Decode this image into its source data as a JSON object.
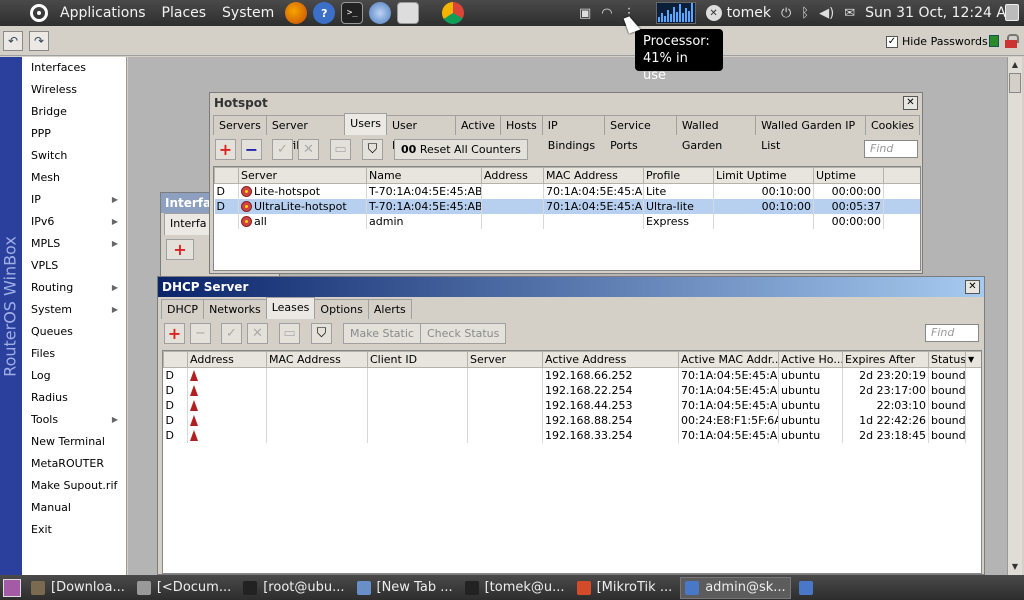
{
  "top_panel": {
    "menus": [
      "Applications",
      "Places",
      "System"
    ],
    "user": "tomek",
    "clock": "Sun 31 Oct, 12:24 AM"
  },
  "tooltip": {
    "line1": "Processor:",
    "line2": "41% in use"
  },
  "winbox_toolbar": {
    "hide_passwords_label": "Hide Passwords",
    "hide_passwords_checked": true
  },
  "brand": "RouterOS WinBox",
  "sidebar": {
    "items": [
      {
        "label": "Interfaces",
        "submenu": false
      },
      {
        "label": "Wireless",
        "submenu": false
      },
      {
        "label": "Bridge",
        "submenu": false
      },
      {
        "label": "PPP",
        "submenu": false
      },
      {
        "label": "Switch",
        "submenu": false
      },
      {
        "label": "Mesh",
        "submenu": false
      },
      {
        "label": "IP",
        "submenu": true
      },
      {
        "label": "IPv6",
        "submenu": true
      },
      {
        "label": "MPLS",
        "submenu": true
      },
      {
        "label": "VPLS",
        "submenu": false
      },
      {
        "label": "Routing",
        "submenu": true
      },
      {
        "label": "System",
        "submenu": true
      },
      {
        "label": "Queues",
        "submenu": false
      },
      {
        "label": "Files",
        "submenu": false
      },
      {
        "label": "Log",
        "submenu": false
      },
      {
        "label": "Radius",
        "submenu": false
      },
      {
        "label": "Tools",
        "submenu": true
      },
      {
        "label": "New Terminal",
        "submenu": false
      },
      {
        "label": "MetaROUTER",
        "submenu": false
      },
      {
        "label": "Make Supout.rif",
        "submenu": false
      },
      {
        "label": "Manual",
        "submenu": false
      },
      {
        "label": "Exit",
        "submenu": false
      }
    ]
  },
  "interface_window": {
    "title": "Interfa",
    "tab": "Interfa"
  },
  "hotspot": {
    "title": "Hotspot",
    "tabs": [
      "Servers",
      "Server Profiles",
      "Users",
      "User Profiles",
      "Active",
      "Hosts",
      "IP Bindings",
      "Service Ports",
      "Walled Garden",
      "Walled Garden IP List",
      "Cookies"
    ],
    "active_tab": "Users",
    "reset_label": "Reset All Counters",
    "reset_prefix": "00",
    "find_placeholder": "Find",
    "columns": [
      "Server",
      "Name",
      "Address",
      "MAC Address",
      "Profile",
      "Limit Uptime",
      "Uptime"
    ],
    "rows": [
      {
        "flag": "D",
        "server": "Lite-hotspot",
        "name": "T-70:1A:04:5E:45:AB",
        "address": "",
        "mac": "70:1A:04:5E:45:AB",
        "profile": "Lite",
        "limit_uptime": "00:10:00",
        "uptime": "00:00:00"
      },
      {
        "flag": "D",
        "server": "UltraLite-hotspot",
        "name": "T-70:1A:04:5E:45:AB",
        "address": "",
        "mac": "70:1A:04:5E:45:AB",
        "profile": "Ultra-lite",
        "limit_uptime": "00:10:00",
        "uptime": "00:05:37"
      },
      {
        "flag": "",
        "server": "all",
        "name": "admin",
        "address": "",
        "mac": "",
        "profile": "Express",
        "limit_uptime": "",
        "uptime": "00:00:00"
      }
    ]
  },
  "dhcp": {
    "title": "DHCP Server",
    "tabs": [
      "DHCP",
      "Networks",
      "Leases",
      "Options",
      "Alerts"
    ],
    "active_tab": "Leases",
    "make_static_label": "Make Static",
    "check_status_label": "Check Status",
    "find_placeholder": "Find",
    "columns": [
      "Address",
      "MAC Address",
      "Client ID",
      "Server",
      "Active Address",
      "Active MAC Addr...",
      "Active Ho...",
      "Expires After",
      "Status"
    ],
    "rows": [
      {
        "flag": "D",
        "active_address": "192.168.66.252",
        "active_mac": "70:1A:04:5E:45:AB",
        "active_host": "ubuntu",
        "expires": "2d 23:20:19",
        "status": "bound"
      },
      {
        "flag": "D",
        "active_address": "192.168.22.254",
        "active_mac": "70:1A:04:5E:45:AB",
        "active_host": "ubuntu",
        "expires": "2d 23:17:00",
        "status": "bound"
      },
      {
        "flag": "D",
        "active_address": "192.168.44.253",
        "active_mac": "70:1A:04:5E:45:AB",
        "active_host": "ubuntu",
        "expires": "22:03:10",
        "status": "bound"
      },
      {
        "flag": "D",
        "active_address": "192.168.88.254",
        "active_mac": "00:24:E8:F1:5F:6A",
        "active_host": "ubuntu",
        "expires": "1d 22:42:26",
        "status": "bound"
      },
      {
        "flag": "D",
        "active_address": "192.168.33.254",
        "active_mac": "70:1A:04:5E:45:AB",
        "active_host": "ubuntu",
        "expires": "2d 23:18:45",
        "status": "bound"
      }
    ]
  },
  "taskbar": {
    "tasks": [
      {
        "label": "[Downloa...",
        "icon_color": "#7a6a50"
      },
      {
        "label": "[<Docum...",
        "icon_color": "#999999"
      },
      {
        "label": "[root@ubu...",
        "icon_color": "#222222"
      },
      {
        "label": "[New Tab ...",
        "icon_color": "#6a8fc8"
      },
      {
        "label": "[tomek@u...",
        "icon_color": "#222222"
      },
      {
        "label": "[MikroTik ...",
        "icon_color": "#d44b2b"
      },
      {
        "label": "admin@sk...",
        "icon_color": "#4a78c8",
        "active": true
      },
      {
        "label": "",
        "icon_color": "#4a78c8"
      }
    ]
  }
}
